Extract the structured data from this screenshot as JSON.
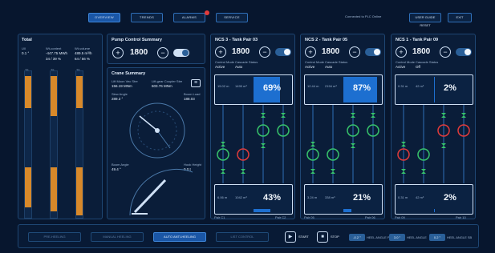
{
  "topbar": {
    "tabs": [
      "OVERVIEW",
      "TRENDS",
      "ALARMS",
      "SERVICE"
    ],
    "connection": "Connected to PLC Online",
    "right_buttons": [
      "USER GUIDE RESET",
      "EXIT"
    ]
  },
  "total": {
    "title": "Total",
    "cols": [
      {
        "label": "Ull",
        "value": "0.1 °"
      },
      {
        "label": "Wt-content",
        "value": "-447.75 MWh"
      },
      {
        "label": "Wt-volume",
        "value": "489.5 m³/h"
      }
    ],
    "line2": "34 / 39 %",
    "line3": "64 / 56 %",
    "scale_top": [
      "75",
      "75",
      "75"
    ],
    "scale_bottom": [
      "0",
      "0",
      "0"
    ]
  },
  "pump_control": {
    "title": "Pump Control Summary",
    "value": "1800"
  },
  "crane": {
    "title": "Crane Summary",
    "col1_label": "Lift Moon Vec Stre",
    "col1_value": "156.19 MNm",
    "col2_label": "Lift-gear Coupler Stre",
    "col2_value": "603.76 MNm",
    "slew_label": "Slew Angle",
    "slew_value": "289.3 °",
    "boom_label": "Boom Load",
    "boom_value": "188.03",
    "angle_label": "Boom Angle",
    "angle_value": "49.4 °",
    "height_label": "Hook Height",
    "height_value": "0.0 t"
  },
  "tanks": [
    {
      "title": "NCS 3 - Tank Pair 03",
      "value": "1800",
      "ctrl_mode_label": "Control Mode",
      "ctrl_mode": "Active",
      "ctrl_dir_label": "Cascade Status",
      "ctrl_dir": "Auto",
      "top_pct": "69%",
      "top_pct_val": 0.69,
      "top_v1": "15.02 m",
      "top_v2": "1495 m³",
      "bot_pct": "43%",
      "bot_pct_val": 0.43,
      "bot_v1": "6.06 m",
      "bot_v2": "1042 m³",
      "label_left": "Pair C1",
      "label_right": "Pair C2"
    },
    {
      "title": "NCS 2 - Tank Pair 05",
      "value": "1800",
      "ctrl_mode_label": "Control Mode",
      "ctrl_mode": "Active",
      "ctrl_dir_label": "Cascade Status",
      "ctrl_dir": "Auto",
      "top_pct": "87%",
      "top_pct_val": 0.87,
      "top_v1": "12.44 m",
      "top_v2": "2194 m³",
      "bot_pct": "21%",
      "bot_pct_val": 0.21,
      "bot_v1": "3.24 m",
      "bot_v2": "338 m³",
      "label_left": "Pair 05",
      "label_right": "Pair 06"
    },
    {
      "title": "NCS 1 - Tank Pair 09",
      "value": "1800",
      "ctrl_mode_label": "Control Mode",
      "ctrl_mode": "Active",
      "ctrl_dir_label": "Cascade Status",
      "ctrl_dir": "Off",
      "top_pct": "2%",
      "top_pct_val": 0.02,
      "top_v1": "0.31 m",
      "top_v2": "42 m³",
      "bot_pct": "2%",
      "bot_pct_val": 0.02,
      "bot_v1": "0.31 m",
      "bot_v2": "42 m³",
      "label_left": "Pair 09",
      "label_right": "Pair 10"
    }
  ],
  "bottom": {
    "buttons": [
      "PRE-HEELING",
      "MANUAL HEELING",
      "AUTO ANTI-HEELING",
      "LIST CONTROL"
    ],
    "start": "START",
    "stop": "STOP",
    "pills": [
      {
        "value": "-0.2 °",
        "label": "HEEL ANGLE PS"
      },
      {
        "value": "3.0 °",
        "label": "HEEL ANGLE"
      },
      {
        "value": "0.2 °",
        "label": "HEEL ANGLE SB"
      }
    ]
  }
}
